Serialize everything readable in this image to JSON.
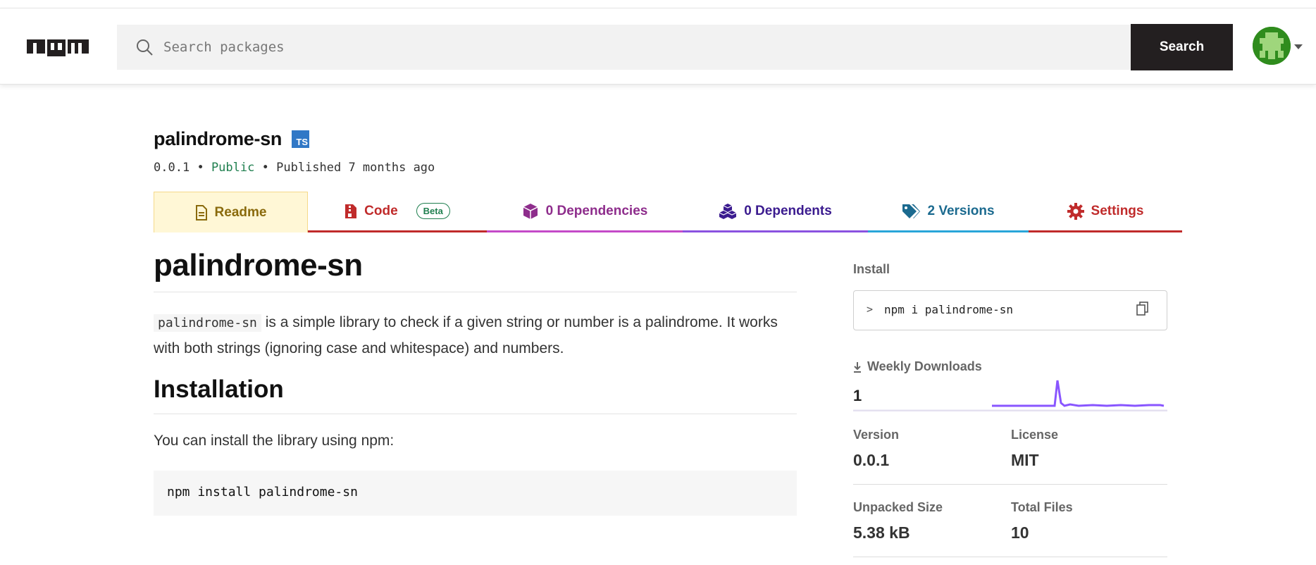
{
  "header": {
    "logo_text": "npm",
    "search_placeholder": "Search packages",
    "search_button": "Search"
  },
  "package": {
    "name": "palindrome-sn",
    "ts_badge": "TS",
    "version": "0.0.1",
    "separator": "•",
    "visibility": "Public",
    "published": "Published 7 months ago"
  },
  "tabs": [
    {
      "label": "Readme",
      "icon": "document-icon"
    },
    {
      "label": "Code",
      "icon": "code-file-icon",
      "badge": "Beta"
    },
    {
      "label": "0 Dependencies",
      "icon": "cube-icon"
    },
    {
      "label": "0 Dependents",
      "icon": "cubes-icon"
    },
    {
      "label": "2 Versions",
      "icon": "tags-icon"
    },
    {
      "label": "Settings",
      "icon": "gear-icon"
    }
  ],
  "readme": {
    "title": "palindrome-sn",
    "intro_code": "palindrome-sn",
    "intro_text": " is a simple library to check if a given string or number is a palindrome. It works with both strings (ignoring case and whitespace) and numbers.",
    "installation_heading": "Installation",
    "installation_text": "You can install the library using npm:",
    "install_code": "npm install palindrome-sn"
  },
  "sidebar": {
    "install_label": "Install",
    "install_prompt": ">",
    "install_command": "npm i palindrome-sn",
    "weekly_downloads_label": "Weekly Downloads",
    "weekly_downloads": "1",
    "stats": {
      "version_label": "Version",
      "version": "0.0.1",
      "license_label": "License",
      "license": "MIT",
      "unpacked_size_label": "Unpacked Size",
      "unpacked_size": "5.38 kB",
      "total_files_label": "Total Files",
      "total_files": "10"
    }
  },
  "colors": {
    "accent_readme": "#fff7d6",
    "code": "#c02b2b",
    "dependencies": "#8e2d8c",
    "dependents": "#3b1b8f",
    "versions": "#1b6a8f",
    "sparkline": "#8956ff"
  }
}
